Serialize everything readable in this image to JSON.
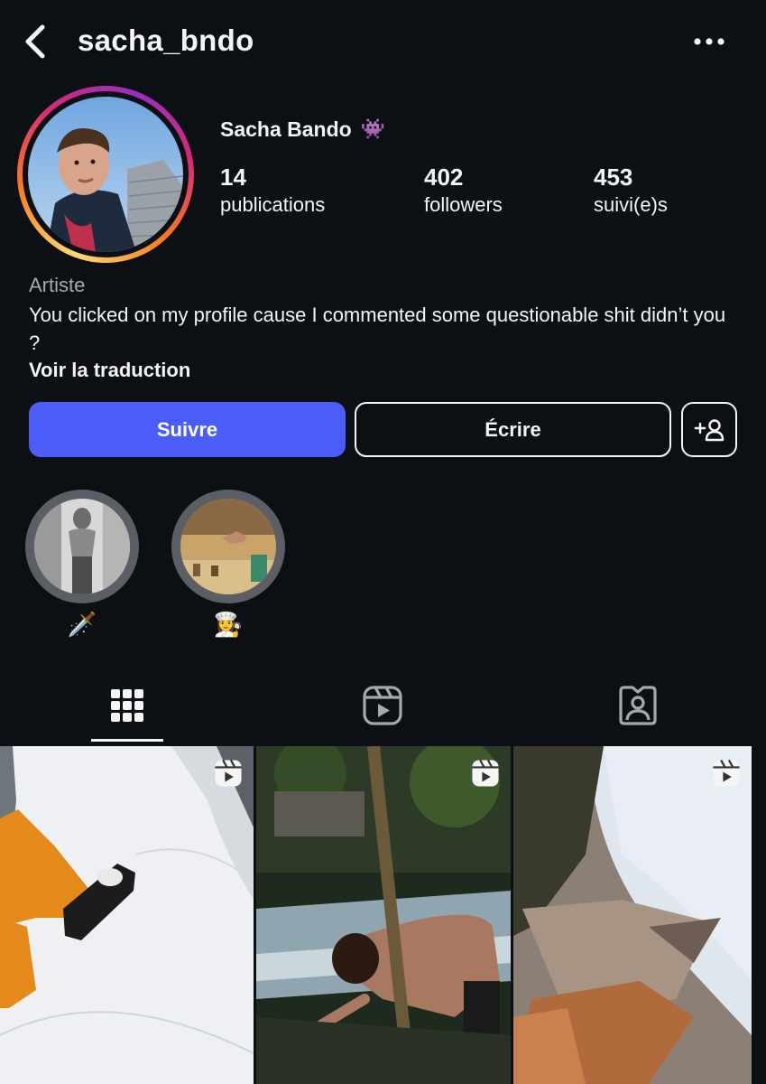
{
  "header": {
    "username": "sacha_bndo",
    "back_icon": "chevron-left-icon",
    "more_icon": "ellipsis-icon"
  },
  "profile": {
    "display_name": "Sacha Bando",
    "name_emoji": "👾",
    "stats": {
      "posts_count": "14",
      "posts_label": "publications",
      "followers_count": "402",
      "followers_label": "followers",
      "following_count": "453",
      "following_label": "suivi(e)s"
    },
    "category": "Artiste",
    "bio": "You clicked on my profile cause I commented some questionable shit didn’t you ?",
    "translate_link": "Voir la traduction"
  },
  "actions": {
    "follow_label": "Suivre",
    "message_label": "Écrire",
    "suggest_icon": "add-person-icon"
  },
  "highlights": [
    {
      "label": "🗡️"
    },
    {
      "label": "👩‍🍳"
    }
  ],
  "tabs": [
    {
      "icon": "grid-icon",
      "active": true
    },
    {
      "icon": "reels-icon",
      "active": false
    },
    {
      "icon": "tagged-icon",
      "active": false
    }
  ],
  "colors": {
    "background": "#0c1014",
    "follow_button": "#4a5df9",
    "text": "#f5f5f5",
    "secondary_text": "#a8a8a8"
  }
}
